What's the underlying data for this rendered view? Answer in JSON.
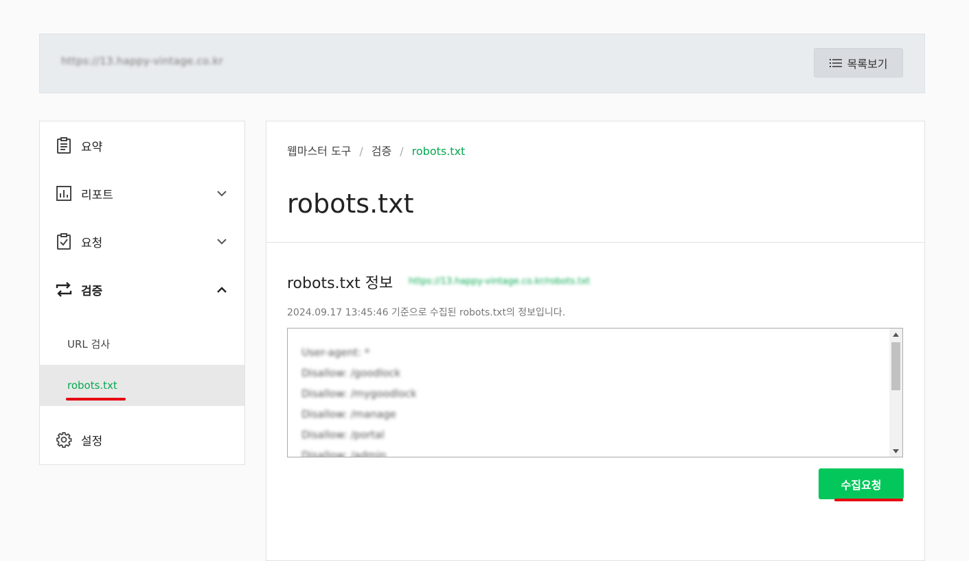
{
  "header": {
    "site_url": "https://13.happy-vintage.co.kr",
    "list_button_label": "목록보기"
  },
  "sidebar": {
    "items": [
      {
        "label": "요약"
      },
      {
        "label": "리포트"
      },
      {
        "label": "요청"
      },
      {
        "label": "검증"
      },
      {
        "label": "설정"
      }
    ],
    "sub_items": [
      {
        "label": "URL 검사"
      },
      {
        "label": "robots.txt"
      }
    ]
  },
  "breadcrumb": {
    "items": [
      "웹마스터 도구",
      "검증",
      "robots.txt"
    ],
    "separator": "/"
  },
  "main": {
    "page_title": "robots.txt",
    "section_title": "robots.txt 정보",
    "section_url": "https://13.happy-vintage.co.kr/robots.txt",
    "info_text": "2024.09.17 13:45:46 기준으로 수집된 robots.txt의 정보입니다.",
    "robots_lines": [
      "User-agent: *",
      "Disallow: /goodlock",
      "Disallow: /mygoodlock",
      "Disallow: /manage",
      "Disallow: /portal",
      "Disallow: /admin"
    ],
    "crawl_button_label": "수집요청"
  },
  "colors": {
    "accent": "#03c75a",
    "accent_text": "#03a94f",
    "highlight_underline": "#e60012"
  }
}
